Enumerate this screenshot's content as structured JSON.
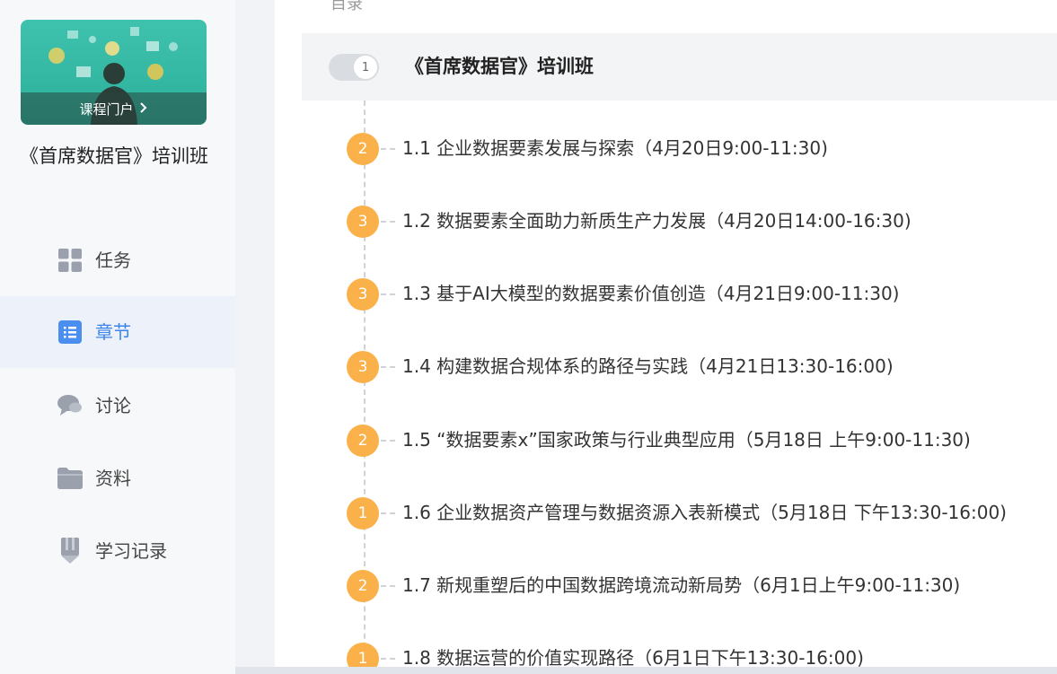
{
  "sidebar": {
    "portal_label": "课程门户",
    "course_title": "《首席数据官》培训班",
    "nav": [
      {
        "label": "任务",
        "icon": "grid-icon",
        "active": false
      },
      {
        "label": "章节",
        "icon": "list-icon",
        "active": true
      },
      {
        "label": "讨论",
        "icon": "chat-bubble-icon",
        "active": false
      },
      {
        "label": "资料",
        "icon": "folder-icon",
        "active": false
      },
      {
        "label": "学习记录",
        "icon": "bookmark-icon",
        "active": false
      }
    ]
  },
  "main": {
    "toc_label": "目录",
    "chapter": {
      "number": "1",
      "title": "《首席数据官》培训班"
    },
    "sections": [
      {
        "badge": "2",
        "title": "1.1 企业数据要素发展与探索（4月20日9:00-11:30)"
      },
      {
        "badge": "3",
        "title": "1.2 数据要素全面助力新质生产力发展（4月20日14:00-16:30)"
      },
      {
        "badge": "3",
        "title": "1.3 基于AI大模型的数据要素价值创造（4月21日9:00-11:30)"
      },
      {
        "badge": "3",
        "title": "1.4 构建数据合规体系的路径与实践（4月21日13:30-16:00)"
      },
      {
        "badge": "2",
        "title": "1.5 “数据要素x”国家政策与行业典型应用（5月18日 上午9:00-11:30)"
      },
      {
        "badge": "1",
        "title": "1.6 企业数据资产管理与数据资源入表新模式（5月18日 下午13:30-16:00)"
      },
      {
        "badge": "2",
        "title": "1.7 新规重塑后的中国数据跨境流动新局势（6月1日上午9:00-11:30)"
      },
      {
        "badge": "1",
        "title": "1.8 数据运营的价值实现路径（6月1日下午13:30-16:00)"
      }
    ]
  },
  "colors": {
    "accent": "#3b86e8",
    "badge": "#fab14a",
    "active_bg": "#edf1f9"
  }
}
